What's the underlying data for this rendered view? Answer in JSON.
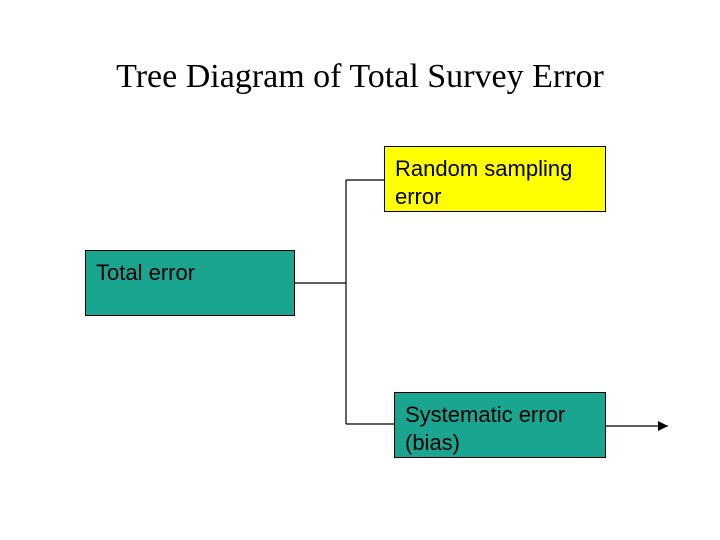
{
  "title": "Tree Diagram of Total Survey Error",
  "boxes": {
    "total": "Total error",
    "random": "Random sampling error",
    "systematic": "Systematic error (bias)"
  }
}
